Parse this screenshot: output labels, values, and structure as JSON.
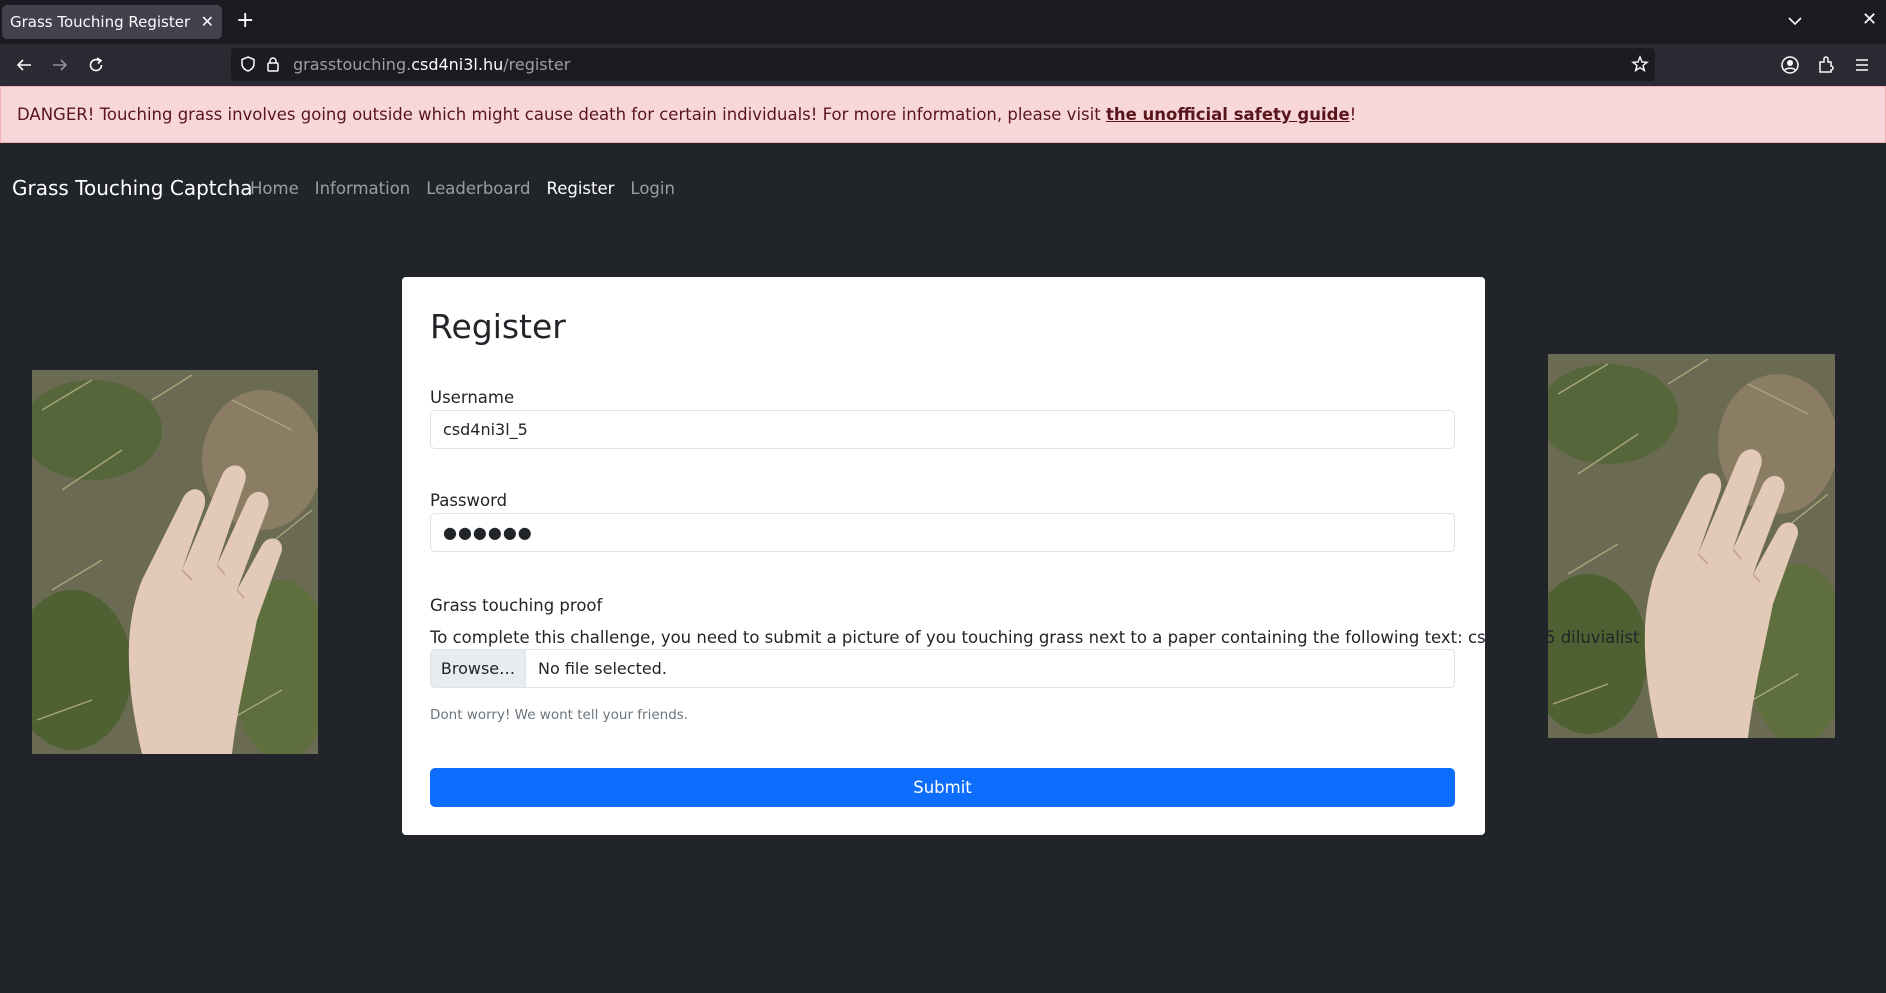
{
  "browser": {
    "tab_title": "Grass Touching Register",
    "url_prefix": "grasstouching.",
    "url_host": "csd4ni3l.hu",
    "url_path": "/register"
  },
  "alert": {
    "text": "DANGER! Touching grass involves going outside which might cause death for certain individuals! For more information, please visit ",
    "link_text": "the unofficial safety guide",
    "suffix": "!"
  },
  "site_nav": {
    "brand": "Grass Touching Captcha",
    "links": [
      {
        "label": "Home",
        "active": false
      },
      {
        "label": "Information",
        "active": false
      },
      {
        "label": "Leaderboard",
        "active": false
      },
      {
        "label": "Register",
        "active": true
      },
      {
        "label": "Login",
        "active": false
      }
    ]
  },
  "form": {
    "title": "Register",
    "username_label": "Username",
    "username_value": "csd4ni3l_5",
    "password_label": "Password",
    "password_display": "●●●●●●",
    "proof_label": "Grass touching proof",
    "proof_description": "To complete this challenge, you need to submit a picture of you touching grass next to a paper containing the following text: csd4ni3l_5 diluvialist",
    "browse_label": "Browse…",
    "file_status": "No file selected.",
    "help_text": "Dont worry! We wont tell your friends.",
    "submit_label": "Submit"
  },
  "colors": {
    "page_bg": "#212529",
    "alert_bg": "#f8d7da",
    "alert_text": "#58151c",
    "primary": "#0d6efd"
  }
}
